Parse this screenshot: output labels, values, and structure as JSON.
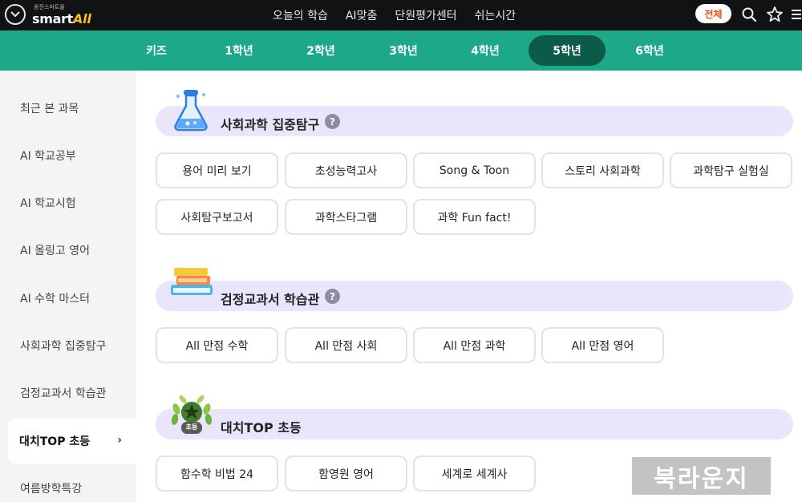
{
  "app": {
    "logo_small": "웅진스마트올",
    "logo_main_prefix": "smart",
    "logo_main_accent": "All"
  },
  "top_nav": {
    "items": [
      "오늘의 학습",
      "AI맞춤",
      "단원평가센터",
      "쉬는시간"
    ],
    "all_label": "전체",
    "icons": [
      "search-icon",
      "star-icon",
      "hamburger-icon"
    ]
  },
  "grades": {
    "tabs": [
      "키즈",
      "1학년",
      "2학년",
      "3학년",
      "4학년",
      "5학년",
      "6학년"
    ],
    "active": "5학년",
    "active_color": "#0c5a48",
    "bar_color": "#1ea88a"
  },
  "sidebar": {
    "items": [
      {
        "label": "최근 본 과목"
      },
      {
        "label": "AI 학교공부"
      },
      {
        "label": "AI 학교시험"
      },
      {
        "label": "AI 올링고 영어"
      },
      {
        "label": "AI 수학 마스터"
      },
      {
        "label": "사회과학 집중탐구"
      },
      {
        "label": "검정교과서 학습관"
      },
      {
        "label": "대치TOP 초등"
      },
      {
        "label": "여름방학특강"
      }
    ],
    "active": "대치TOP 초등",
    "chevron": "›"
  },
  "sections": [
    {
      "title": "사회과학 집중탐구",
      "help": "?",
      "icon": "flask-icon",
      "chips": [
        "용어 미리 보기",
        "초성능력고사",
        "Song & Toon",
        "스토리 사회과학",
        "과학탐구 실험실",
        "사회탐구보고서",
        "과학스타그램",
        "과학 Fun fact!"
      ]
    },
    {
      "title": "검정교과서 학습관",
      "help": "?",
      "icon": "books-icon",
      "chips": [
        "All 만점 수학",
        "All 만점 사회",
        "All 만점 과학",
        "All 만점 영어"
      ]
    },
    {
      "title": "대치TOP 초등",
      "help": "",
      "icon": "laurel-badge-icon",
      "icon_badge_text": "초등",
      "chips": [
        "함수학 비법 24",
        "함영원 영어",
        "세계로 세계사"
      ]
    }
  ],
  "watermark": "북라운지",
  "colors": {
    "section_bar": "#e9e6fb",
    "all_pill_text": "#e2561c",
    "logo_accent": "#f4c21a"
  }
}
